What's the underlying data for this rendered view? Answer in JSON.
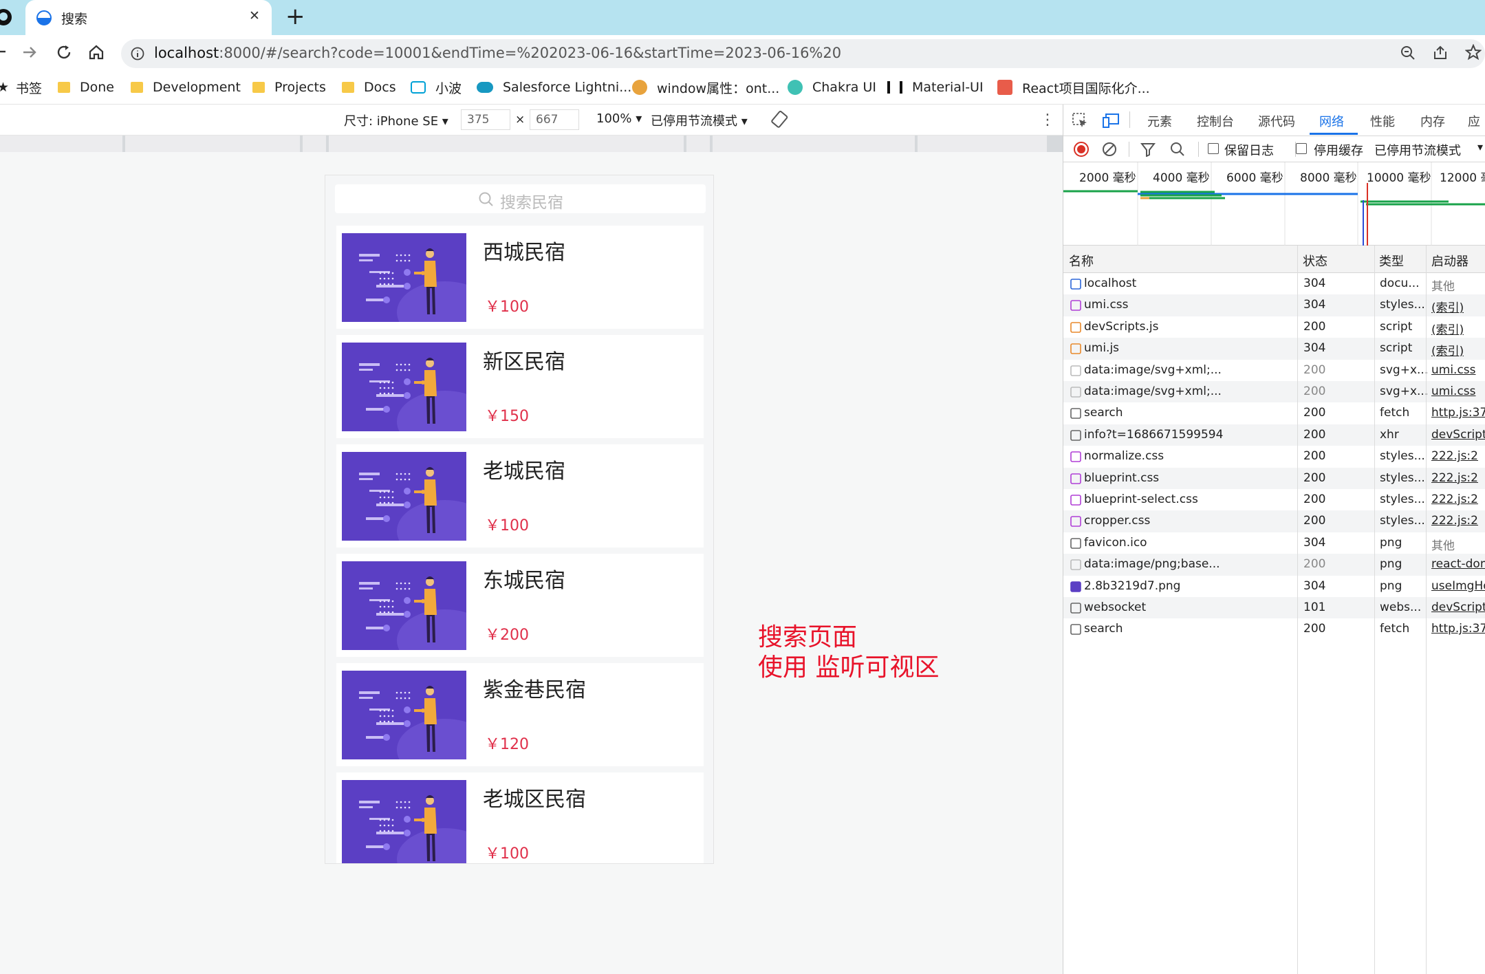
{
  "browser": {
    "tab": {
      "title": "搜索",
      "close": "✕"
    },
    "new_tab": "+",
    "address": {
      "host": "localhost",
      "rest": ":8000/#/search?code=10001&endTime=%202023-06-16&startTime=2023-06-16%20"
    },
    "bookmarks": [
      {
        "label": "书签",
        "icon": "star-icon"
      },
      {
        "label": "Done",
        "icon": "folder-icon"
      },
      {
        "label": "Development",
        "icon": "folder-icon"
      },
      {
        "label": "Projects",
        "icon": "folder-icon"
      },
      {
        "label": "Docs",
        "icon": "folder-icon"
      },
      {
        "label": "小波",
        "icon": "bilibili-icon"
      },
      {
        "label": "Salesforce Lightni...",
        "icon": "salesforce-icon"
      },
      {
        "label": "window属性：ont...",
        "icon": "site-icon"
      },
      {
        "label": "Chakra UI",
        "icon": "chakra-icon"
      },
      {
        "label": "Material-UI",
        "icon": "material-icon"
      },
      {
        "label": "React项目国际化介...",
        "icon": "jianshu-icon"
      }
    ]
  },
  "device_toolbar": {
    "size_label": "尺寸: iPhone SE",
    "width": "375",
    "x": "×",
    "height": "667",
    "zoom": "100%",
    "throttle": "已停用节流模式"
  },
  "app": {
    "search_placeholder": "搜索民宿",
    "listings": [
      {
        "name": "西城民宿",
        "price": "￥100"
      },
      {
        "name": "新区民宿",
        "price": "￥150"
      },
      {
        "name": "老城民宿",
        "price": "￥100"
      },
      {
        "name": "东城民宿",
        "price": "￥200"
      },
      {
        "name": "紫金巷民宿",
        "price": "￥120"
      },
      {
        "name": "老城区民宿",
        "price": "￥100"
      }
    ]
  },
  "annotation": {
    "line1": "搜索页面",
    "line2": "使用 监听可视区"
  },
  "devtools": {
    "tabs": [
      "元素",
      "控制台",
      "源代码",
      "网络",
      "性能",
      "内存",
      "应"
    ],
    "active_tab": "网络",
    "toolbar": {
      "preserve_log": "保留日志",
      "disable_cache": "停用缓存",
      "throttle": "已停用节流模式"
    },
    "timeline_ticks": [
      "2000 毫秒",
      "4000 毫秒",
      "6000 毫秒",
      "8000 毫秒",
      "10000 毫秒",
      "12000 毫"
    ],
    "columns": {
      "name": "名称",
      "status": "状态",
      "type": "类型",
      "initiator": "启动器"
    },
    "requests": [
      {
        "name": "localhost",
        "status": "304",
        "type": "docu...",
        "initiator": "其他",
        "link": false,
        "icon": "doc"
      },
      {
        "name": "umi.css",
        "status": "304",
        "type": "styles...",
        "initiator": "(索引)",
        "link": true,
        "icon": "css"
      },
      {
        "name": "devScripts.js",
        "status": "200",
        "type": "script",
        "initiator": "(索引)",
        "link": true,
        "icon": "js"
      },
      {
        "name": "umi.js",
        "status": "304",
        "type": "script",
        "initiator": "(索引)",
        "link": true,
        "icon": "js"
      },
      {
        "name": "data:image/svg+xml;...",
        "status": "200",
        "type": "svg+x...",
        "initiator": "umi.css",
        "link": true,
        "icon": "img"
      },
      {
        "name": "data:image/svg+xml;...",
        "status": "200",
        "type": "svg+x...",
        "initiator": "umi.css",
        "link": true,
        "icon": "img"
      },
      {
        "name": "search",
        "status": "200",
        "type": "fetch",
        "initiator": "http.js:37",
        "link": true,
        "icon": "box"
      },
      {
        "name": "info?t=1686671599594",
        "status": "200",
        "type": "xhr",
        "initiator": "devScripts",
        "link": true,
        "icon": "box"
      },
      {
        "name": "normalize.css",
        "status": "200",
        "type": "styles...",
        "initiator": "222.js:2",
        "link": true,
        "icon": "css"
      },
      {
        "name": "blueprint.css",
        "status": "200",
        "type": "styles...",
        "initiator": "222.js:2",
        "link": true,
        "icon": "css"
      },
      {
        "name": "blueprint-select.css",
        "status": "200",
        "type": "styles...",
        "initiator": "222.js:2",
        "link": true,
        "icon": "css"
      },
      {
        "name": "cropper.css",
        "status": "200",
        "type": "styles...",
        "initiator": "222.js:2",
        "link": true,
        "icon": "css"
      },
      {
        "name": "favicon.ico",
        "status": "304",
        "type": "png",
        "initiator": "其他",
        "link": false,
        "icon": "box"
      },
      {
        "name": "data:image/png;base...",
        "status": "200",
        "type": "png",
        "initiator": "react-dom",
        "link": true,
        "icon": "img"
      },
      {
        "name": "2.8b3219d7.png",
        "status": "304",
        "type": "png",
        "initiator": "useImgHo",
        "link": true,
        "icon": "png"
      },
      {
        "name": "websocket",
        "status": "101",
        "type": "webs...",
        "initiator": "devScripts",
        "link": true,
        "icon": "box"
      },
      {
        "name": "search",
        "status": "200",
        "type": "fetch",
        "initiator": "http.js:37",
        "link": true,
        "icon": "box"
      }
    ]
  },
  "colors": {
    "accent": "#1a73e8",
    "price": "#e0304a",
    "annotation": "#e8132a",
    "thumb": "#5b3fc4"
  }
}
